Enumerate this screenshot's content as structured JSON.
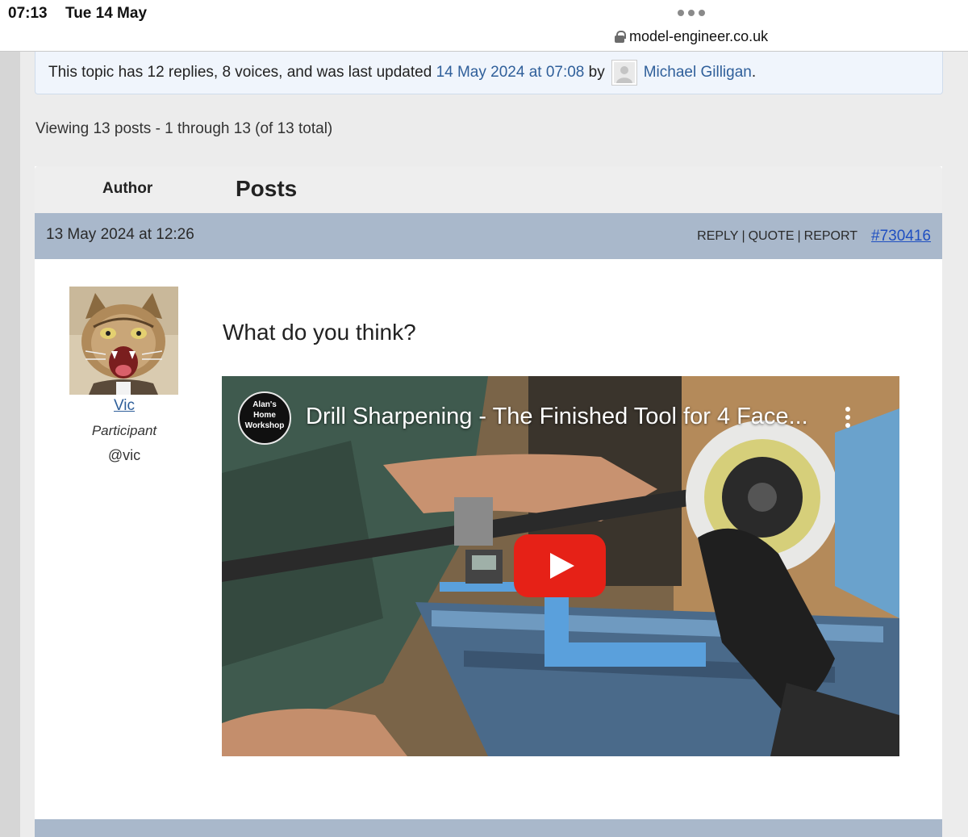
{
  "status_bar": {
    "time": "07:13",
    "date": "Tue 14 May",
    "url": "model-engineer.co.uk"
  },
  "notice": {
    "prefix": "This topic has 12 replies, 8 voices, and was last updated",
    "updated_link": "14 May 2024 at 07:08",
    "by": "by",
    "user": "Michael Gilligan",
    "suffix": "."
  },
  "viewing": "Viewing 13 posts - 1 through 13 (of 13 total)",
  "table_head": {
    "author": "Author",
    "posts": "Posts"
  },
  "post": {
    "date": "13 May 2024 at 12:26",
    "actions": [
      "REPLY",
      "QUOTE",
      "REPORT"
    ],
    "permalink": "#730416",
    "author_name": "Vic",
    "author_role": "Participant",
    "author_handle": "@vic",
    "avatar_icon": "angry-cat-avatar",
    "body": "What do you think?",
    "video": {
      "title": "Drill Sharpening - The Finished Tool for 4 Face...",
      "channel_line1": "Alan's",
      "channel_line2": "Home",
      "channel_line3": "Workshop",
      "play_icon": "youtube-play-icon",
      "menu_icon": "more-vertical-icon"
    }
  },
  "colors": {
    "post_header": "#a9b8cb",
    "link": "#2f5f9a",
    "permalink": "#1f4fc1",
    "notice_bg": "#f0f5fc",
    "youtube_red": "#e62117"
  }
}
